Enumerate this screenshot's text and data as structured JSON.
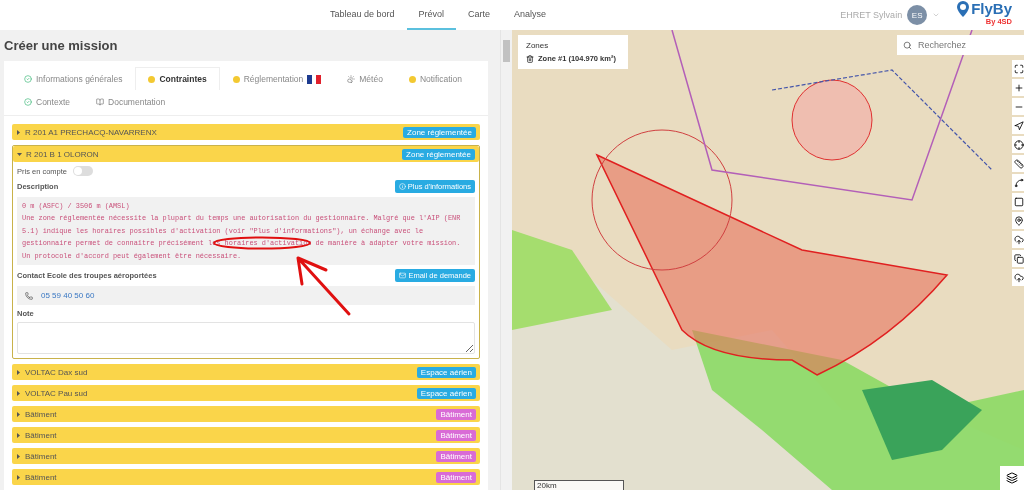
{
  "nav": {
    "items": [
      {
        "label": "Tableau de bord",
        "selected": false
      },
      {
        "label": "Prévol",
        "selected": true
      },
      {
        "label": "Carte",
        "selected": false
      },
      {
        "label": "Analyse",
        "selected": false
      }
    ]
  },
  "user": {
    "name": "EHRET Sylvain",
    "initials": "ES"
  },
  "logo": {
    "name": "FlyBy",
    "tagline": "By 4SD"
  },
  "page": {
    "title": "Créer une mission"
  },
  "tabs": [
    {
      "label": "Informations générales",
      "kind": "done",
      "selected": false,
      "flag": false
    },
    {
      "label": "Contraintes",
      "kind": "pending",
      "selected": true,
      "flag": false
    },
    {
      "label": "Réglementation",
      "kind": "pending",
      "selected": false,
      "flag": true
    },
    {
      "label": "Météo",
      "kind": "weather",
      "selected": false,
      "flag": false
    },
    {
      "label": "Notification",
      "kind": "pending",
      "selected": false,
      "flag": false
    },
    {
      "label": "Contexte",
      "kind": "done",
      "selected": false,
      "flag": false
    },
    {
      "label": "Documentation",
      "kind": "docs",
      "selected": false,
      "flag": false
    }
  ],
  "constraints": [
    {
      "title": "R 201 A1 PRECHACQ-NAVARRENX",
      "badge": "Zone réglementée",
      "color": "#29abe2",
      "expanded": false
    },
    {
      "title": "R 201 B 1 OLORON",
      "badge": "Zone réglementée",
      "color": "#29abe2",
      "expanded": true,
      "details": {
        "toggle": {
          "label": "Pris en compte",
          "on": false
        },
        "description": {
          "label": "Description",
          "button": "Plus d'informations",
          "altitude": "0 m (ASFC) / 3506 m (AMSL)",
          "text": "Une zone réglementée nécessite la plupart du temps une autorisation du gestionnaire. Malgré que l'AIP (ENR 5.1) indique les horaires possibles d'activation (voir \"Plus d'informations\"), un échange avec le gestionnaire permet de connaître précisément les horaires d'activation de manière à adapter votre mission. Un protocole d'accord peut également être nécessaire."
        },
        "contact": {
          "label": "Contact Ecole des troupes aéroportées",
          "button": "Email de demande",
          "phone": "05 59 40 50 60"
        },
        "note": {
          "label": "Note"
        }
      }
    },
    {
      "title": "VOLTAC Dax sud",
      "badge": "Espace aérien",
      "color": "#29abe2",
      "expanded": false
    },
    {
      "title": "VOLTAC Pau sud",
      "badge": "Espace aérien",
      "color": "#29abe2",
      "expanded": false
    },
    {
      "title": "Bâtiment",
      "badge": "Bâtiment",
      "color": "#d96bd6",
      "expanded": false
    },
    {
      "title": "Bâtiment",
      "badge": "Bâtiment",
      "color": "#d96bd6",
      "expanded": false
    },
    {
      "title": "Bâtiment",
      "badge": "Bâtiment",
      "color": "#d96bd6",
      "expanded": false
    },
    {
      "title": "Bâtiment",
      "badge": "Bâtiment",
      "color": "#d96bd6",
      "expanded": false
    }
  ],
  "map": {
    "zones_panel": {
      "title": "Zones",
      "zone": "Zone #1 (104.970 km²)"
    },
    "search": {
      "placeholder": "Recherchez"
    },
    "scale": "20km"
  }
}
